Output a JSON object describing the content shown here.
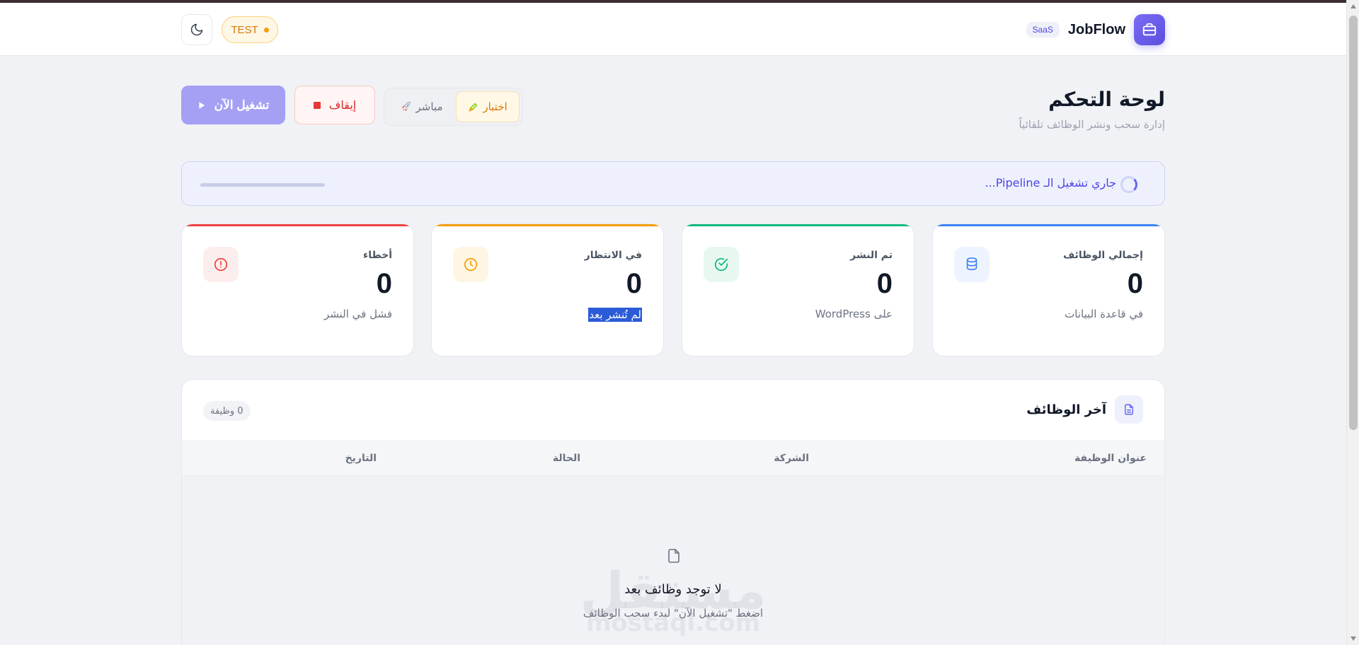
{
  "header": {
    "brand_name": "JobFlow",
    "saas_badge": "SaaS",
    "env_badge": "TEST"
  },
  "title": {
    "heading": "لوحة التحكم",
    "subtitle": "إدارة سحب ونشر الوظائف تلقائياً"
  },
  "actions": {
    "run_label": "تشغيل الآن",
    "stop_label": "إيقاف",
    "mode_test_label": "اختبار",
    "mode_live_label": "مباشر"
  },
  "progress": {
    "text": "جاري تشغيل الـ Pipeline..."
  },
  "stats": [
    {
      "label": "إجمالي الوظائف",
      "value": "0",
      "sub": "في قاعدة البيانات",
      "color": "#3b82f6",
      "icon": "database-icon"
    },
    {
      "label": "تم النشر",
      "value": "0",
      "sub": "على WordPress",
      "color": "#10b981",
      "icon": "check-circle-icon"
    },
    {
      "label": "في الانتظار",
      "value": "0",
      "sub": "لم تُنشر بعد",
      "color": "#f59e0b",
      "icon": "clock-icon"
    },
    {
      "label": "أخطاء",
      "value": "0",
      "sub": "فشل في النشر",
      "color": "#ef4444",
      "icon": "alert-circle-icon"
    }
  ],
  "jobs": {
    "title": "آخر الوظائف",
    "count": "0 وظيفة",
    "columns": [
      "عنوان الوظيفة",
      "الشركة",
      "الحالة",
      "التاريخ"
    ],
    "empty_title": "لا توجد وظائف بعد",
    "empty_sub": "اضغط \"تشغيل الآن\" لبدء سحب الوظائف"
  },
  "watermark": {
    "main": "مستقل",
    "sub": "mostaql.com"
  }
}
